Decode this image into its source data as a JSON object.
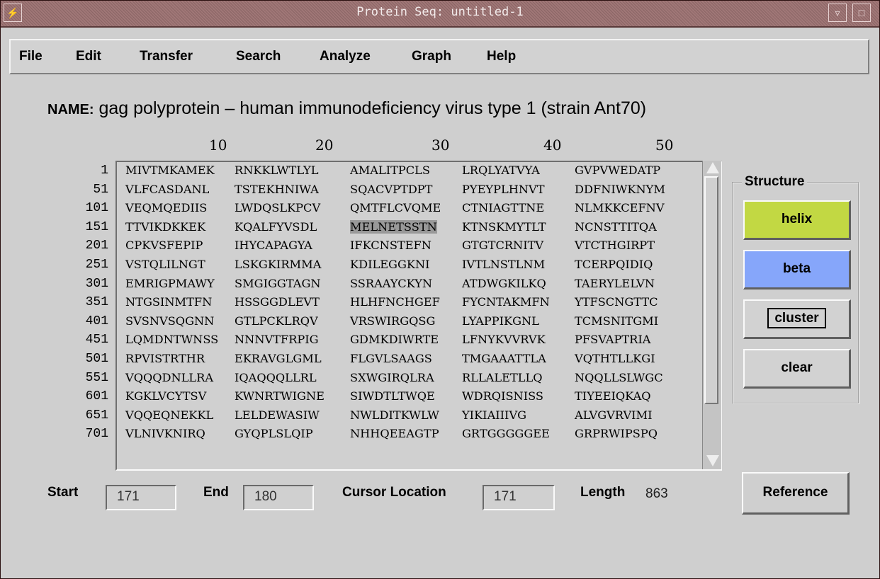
{
  "window": {
    "title": "Protein Seq: untitled-1"
  },
  "menu": [
    "File",
    "Edit",
    "Transfer",
    "Search",
    "Analyze",
    "Graph",
    "Help"
  ],
  "name": {
    "label": "NAME:",
    "value": "gag polyprotein – human immunodeficiency virus type 1 (strain Ant70)"
  },
  "ruler": [
    "10",
    "20",
    "30",
    "40",
    "50"
  ],
  "sequence": {
    "rows": [
      {
        "num": "1",
        "blocks": [
          "MIVTMKAMEK",
          "RNKKLWTLYL",
          "AMALITPCLS",
          "LRQLYATVYA",
          "GVPVWEDATP"
        ]
      },
      {
        "num": "51",
        "blocks": [
          "VLFCASDANL",
          "TSTEKHNIWA",
          "SQACVPTDPT",
          "PYEYPLHNVT",
          "DDFNIWKNYM"
        ]
      },
      {
        "num": "101",
        "blocks": [
          "VEQMQEDIIS",
          "LWDQSLKPCV",
          "QMTFLCVQME",
          "CTNIAGTTNE",
          "NLMKKCEFNV"
        ]
      },
      {
        "num": "151",
        "blocks": [
          "TTVIKDKKEK",
          "KQALFYVSDL",
          "MELNETSSTN",
          "KTNSKMYTLT",
          "NCNSTTITQA"
        ]
      },
      {
        "num": "201",
        "blocks": [
          "CPKVSFEPIP",
          "IHYCAPAGYA",
          "IFKCNSTEFN",
          "GTGTCRNITV",
          "VTCTHGIRPT"
        ]
      },
      {
        "num": "251",
        "blocks": [
          "VSTQLILNGT",
          "LSKGKIRMMA",
          "KDILEGGKNI",
          "IVTLNSTLNM",
          "TCERPQIDIQ"
        ]
      },
      {
        "num": "301",
        "blocks": [
          "EMRIGPMAWY",
          "SMGIGGTAGN",
          "SSRAAYCKYN",
          "ATDWGKILKQ",
          "TAERYLELVN"
        ]
      },
      {
        "num": "351",
        "blocks": [
          "NTGSINMTFN",
          "HSSGGDLEVT",
          "HLHFNCHGEF",
          "FYCNTAKMFN",
          "YTFSCNGTTC"
        ]
      },
      {
        "num": "401",
        "blocks": [
          "SVSNVSQGNN",
          "GTLPCKLRQV",
          "VRSWIRGQSG",
          "LYAPPIKGNL",
          "TCMSNITGMI"
        ]
      },
      {
        "num": "451",
        "blocks": [
          "LQMDNTWNSS",
          "NNNVTFRPIG",
          "GDMKDIWRTE",
          "LFNYKVVRVK",
          "PFSVAPTRIA"
        ]
      },
      {
        "num": "501",
        "blocks": [
          "RPVISTRTHR",
          "EKRAVGLGML",
          "FLGVLSAAGS",
          "TMGAAATTLA",
          "VQTHTLLKGI"
        ]
      },
      {
        "num": "551",
        "blocks": [
          "VQQQDNLLRA",
          "IQAQQQLLRL",
          "SXWGIRQLRA",
          "RLLALETLLQ",
          "NQQLLSLWGC"
        ]
      },
      {
        "num": "601",
        "blocks": [
          "KGKLVCYTSV",
          "KWNRTWIGNE",
          "SIWDTLTWQE",
          "WDRQISNISS",
          "TIYEEIQKAQ"
        ]
      },
      {
        "num": "651",
        "blocks": [
          "VQQEQNEKKL",
          "LELDEWASIW",
          "NWLDITKWLW",
          "YIKIAIIIVG",
          "ALVGVRVIMI"
        ]
      },
      {
        "num": "701",
        "blocks": [
          "VLNIVKNIRQ",
          "GYQPLSLQIP",
          "NHHQEEAGTP",
          "GRTGGGGGEE",
          "GRPRWIPSPQ"
        ]
      }
    ],
    "selection": {
      "row": 3,
      "block": 2
    }
  },
  "structure": {
    "legend": "Structure",
    "helix": "helix",
    "beta": "beta",
    "cluster": "cluster",
    "clear": "clear",
    "helix_color": "#c2d843",
    "beta_color": "#86a6fa"
  },
  "footer": {
    "start_label": "Start",
    "start_value": "171",
    "end_label": "End",
    "end_value": "180",
    "cursor_label": "Cursor Location",
    "cursor_value": "171",
    "length_label": "Length",
    "length_value": "863"
  },
  "reference_button": "Reference"
}
